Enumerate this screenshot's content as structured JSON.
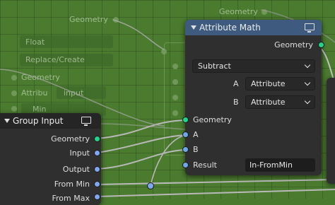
{
  "background_labels": {
    "geometry_top": "Geometry",
    "float": "Float",
    "replace_create": "Replace/Create",
    "geometry_left": "Geometry",
    "attribute": "Attribu",
    "input": "input",
    "min": "Min"
  },
  "attribute_math_node": {
    "title": "Attribute Math",
    "output_geometry": "Geometry",
    "operation": "Subtract",
    "a_label": "A",
    "a_type": "Attribute",
    "b_label": "B",
    "b_type": "Attribute",
    "inputs": {
      "geometry": "Geometry",
      "a": "A",
      "b": "B",
      "result": "Result"
    },
    "result_value": "In-FromMin"
  },
  "group_input_node": {
    "title": "Group Input",
    "outputs": [
      "Geometry",
      "Input",
      "Output",
      "From Min",
      "From Max"
    ]
  },
  "colors": {
    "canvas": "#4b7b2f",
    "node_body": "#2f2f2f",
    "attr_math_header": "#3e5a7f",
    "group_input_header": "#252525",
    "geometry_socket": "#21d38b",
    "value_socket": "#7fa6ee"
  }
}
